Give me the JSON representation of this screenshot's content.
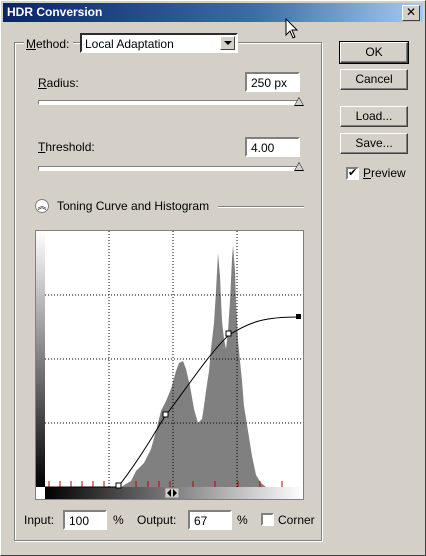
{
  "window": {
    "title": "HDR Conversion",
    "close_glyph": "✕"
  },
  "method": {
    "label": "Method:",
    "label_ul": "M",
    "label_rest": "ethod:",
    "value": "Local Adaptation"
  },
  "radius": {
    "label_ul": "R",
    "label_rest": "adius:",
    "value": "250 px",
    "slider": 1.0
  },
  "threshold": {
    "label_ul": "T",
    "label_rest": "hreshold:",
    "value": "4.00",
    "slider": 1.0
  },
  "toning": {
    "title": "Toning Curve and Histogram"
  },
  "buttons": {
    "ok": "OK",
    "cancel": "Cancel",
    "load": "Load...",
    "save": "Save..."
  },
  "preview": {
    "label_ul": "P",
    "label_rest": "review",
    "checked": true
  },
  "bottom": {
    "input_label": "Input:",
    "input_value": "100",
    "input_unit": "%",
    "output_label": "Output:",
    "output_value": "67",
    "output_unit": "%",
    "corner_label": "Corner"
  },
  "icons": {
    "chevron": "chevron-up-icon",
    "cursor": "arrow-cursor-icon"
  }
}
